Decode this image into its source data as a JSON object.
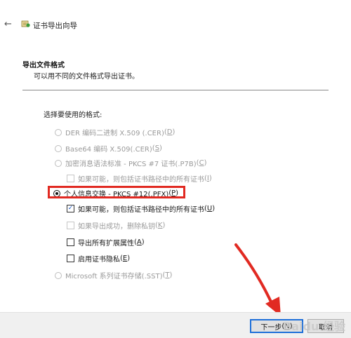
{
  "window": {
    "title": "证书导出向导"
  },
  "header": {
    "section_title": "导出文件格式",
    "section_desc": "可以用不同的文件格式导出证书。"
  },
  "form": {
    "format_prompt": "选择要使用的格式:",
    "options": [
      {
        "label": "DER 编码二进制 X.509 (.CER)",
        "mnemonic": "D",
        "selected": false,
        "enabled": false
      },
      {
        "label": "Base64 编码 X.509(.CER)",
        "mnemonic": "S",
        "selected": false,
        "enabled": false
      },
      {
        "label": "加密消息语法标准 - PKCS #7 证书(.P7B)",
        "mnemonic": "C",
        "selected": false,
        "enabled": false
      },
      {
        "label": "个人信息交换 - PKCS #12(.PFX)",
        "mnemonic": "P",
        "selected": true,
        "enabled": true
      },
      {
        "label": "Microsoft 系列证书存储(.SST)",
        "mnemonic": "T",
        "selected": false,
        "enabled": false
      }
    ],
    "checkboxes": {
      "p7b_include_all": {
        "label": "如果可能，则包括证书路径中的所有证书",
        "mnemonic": "I",
        "checked": false,
        "enabled": false
      },
      "pfx_include_all": {
        "label": "如果可能，则包括证书路径中的所有证书",
        "mnemonic": "U",
        "checked": true,
        "enabled": true
      },
      "delete_private_key": {
        "label": "如果导出成功，删除私钥",
        "mnemonic": "K",
        "checked": false,
        "enabled": false
      },
      "export_ext_props": {
        "label": "导出所有扩展属性",
        "mnemonic": "A",
        "checked": false,
        "enabled": true
      },
      "enable_privacy": {
        "label": "启用证书隐私",
        "mnemonic": "E",
        "checked": false,
        "enabled": true
      }
    }
  },
  "footer": {
    "next_label": "下一步",
    "next_mnemonic": "N",
    "cancel_label": "取消"
  },
  "watermark": "Baidu 经验",
  "colors": {
    "highlight": "#e12a22",
    "arrow": "#e12a22",
    "primary_border": "#1e6fd9"
  },
  "icons": {
    "back": "back-arrow-icon",
    "wizard": "certificate-icon"
  }
}
